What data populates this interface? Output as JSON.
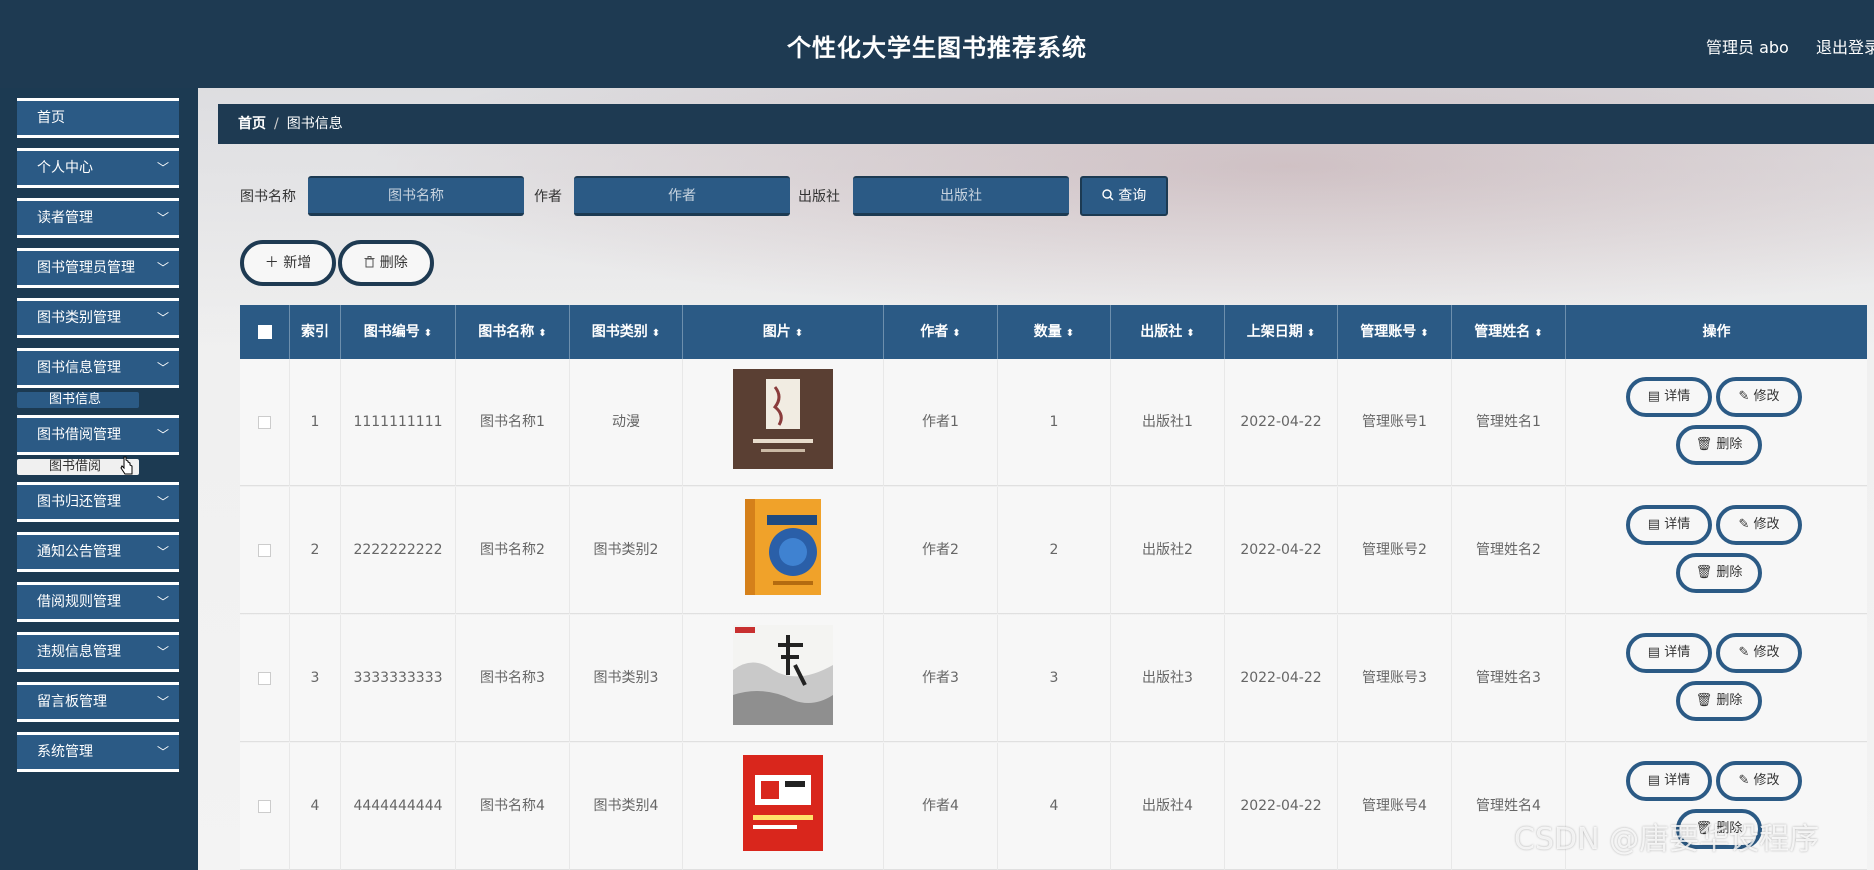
{
  "header": {
    "title": "个性化大学生图书推荐系统",
    "user": "管理员 abo",
    "logout": "退出登录"
  },
  "sidebar": {
    "items": [
      {
        "label": "首页",
        "chevron": ""
      },
      {
        "label": "个人中心",
        "chevron": "﹀"
      },
      {
        "label": "读者管理",
        "chevron": "﹀"
      },
      {
        "label": "图书管理员管理",
        "chevron": "﹀"
      },
      {
        "label": "图书类别管理",
        "chevron": "﹀"
      },
      {
        "label": "图书信息管理",
        "chevron": "﹀"
      },
      {
        "label": "图书借阅管理",
        "chevron": "﹀"
      },
      {
        "label": "图书归还管理",
        "chevron": "﹀"
      },
      {
        "label": "通知公告管理",
        "chevron": "﹀"
      },
      {
        "label": "借阅规则管理",
        "chevron": "﹀"
      },
      {
        "label": "违规信息管理",
        "chevron": "﹀"
      },
      {
        "label": "留言板管理",
        "chevron": "﹀"
      },
      {
        "label": "系统管理",
        "chevron": "﹀"
      }
    ],
    "sub_items": [
      "图书信息",
      "图书借阅"
    ]
  },
  "breadcrumb": {
    "home": "首页",
    "sep": "/",
    "current": "图书信息"
  },
  "search": {
    "name_label": "图书名称",
    "name_placeholder": "图书名称",
    "author_label": "作者",
    "author_placeholder": "作者",
    "publisher_label": "出版社",
    "publisher_placeholder": "出版社",
    "query_label": "查询"
  },
  "toolbar": {
    "add_label": "新增",
    "delete_label": "删除"
  },
  "table": {
    "headers": [
      "索引",
      "图书编号",
      "图书名称",
      "图书类别",
      "图片",
      "作者",
      "数量",
      "出版社",
      "上架日期",
      "管理账号",
      "管理姓名",
      "操作"
    ],
    "sort_glyph": "⬍",
    "rows": [
      {
        "index": "1",
        "code": "1111111111",
        "name": "图书名称1",
        "category": "动漫",
        "author": "作者1",
        "qty": "1",
        "publisher": "出版社1",
        "date": "2022-04-22",
        "account": "管理账号1",
        "manager": "管理姓名1"
      },
      {
        "index": "2",
        "code": "2222222222",
        "name": "图书名称2",
        "category": "图书类别2",
        "author": "作者2",
        "qty": "2",
        "publisher": "出版社2",
        "date": "2022-04-22",
        "account": "管理账号2",
        "manager": "管理姓名2"
      },
      {
        "index": "3",
        "code": "3333333333",
        "name": "图书名称3",
        "category": "图书类别3",
        "author": "作者3",
        "qty": "3",
        "publisher": "出版社3",
        "date": "2022-04-22",
        "account": "管理账号3",
        "manager": "管理姓名3"
      },
      {
        "index": "4",
        "code": "4444444444",
        "name": "图书名称4",
        "category": "图书类别4",
        "author": "作者4",
        "qty": "4",
        "publisher": "出版社4",
        "date": "2022-04-22",
        "account": "管理账号4",
        "manager": "管理姓名4"
      }
    ],
    "actions": {
      "detail": "详情",
      "edit": "修改",
      "delete": "删除"
    }
  },
  "watermark": "CSDN @唐要华设程序",
  "colors": {
    "header_bg": "#1e3a52",
    "accent": "#2b5a85",
    "content_bg": "#f7f7f7"
  }
}
